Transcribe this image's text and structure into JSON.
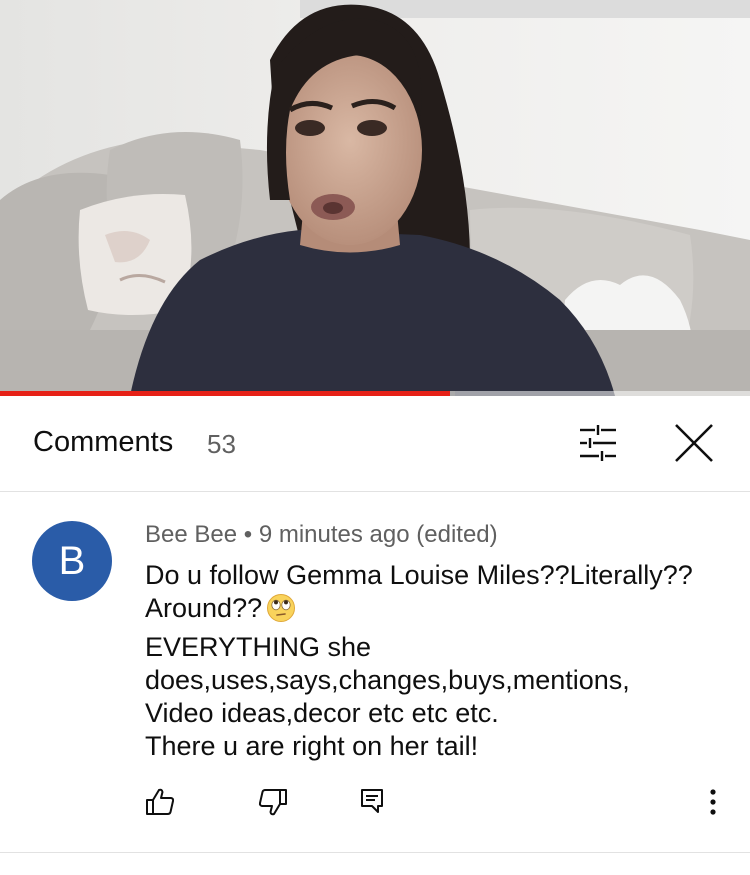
{
  "video": {
    "progress_fraction": 0.6,
    "buffer_fraction": 0.607
  },
  "comments_panel": {
    "title": "Comments",
    "count": "53",
    "filter_icon": "tune-icon",
    "close_icon": "close-icon"
  },
  "comment": {
    "avatar_letter": "B",
    "avatar_color": "#2a5ca8",
    "author": "Bee Bee",
    "separator": "•",
    "time": "9 minutes ago (edited)",
    "lines": [
      "Do u follow Gemma Louise Miles??Literally??",
      "Around??",
      "EVERYTHING she",
      "does,uses,says,changes,buys,mentions,",
      "Video ideas,decor etc etc etc.",
      "There u are right on her tail!"
    ],
    "emoji": "face-with-rolling-eyes-emoji",
    "actions": {
      "like_icon": "thumbs-up-icon",
      "dislike_icon": "thumbs-down-icon",
      "reply_icon": "reply-icon",
      "more_icon": "more-vert-icon"
    }
  },
  "colors": {
    "accent_red": "#e62117",
    "text_primary": "#0f0f0f",
    "text_secondary": "#606060"
  }
}
